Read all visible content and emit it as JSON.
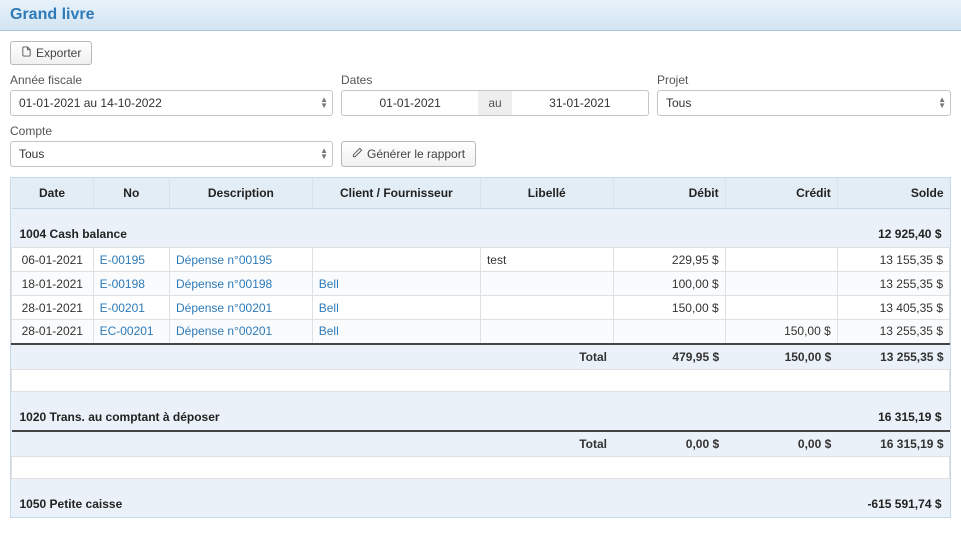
{
  "title": "Grand livre",
  "buttons": {
    "export": "Exporter",
    "generate": "Générer le rapport"
  },
  "filters": {
    "fiscal_year": {
      "label": "Année fiscale",
      "value": "01-01-2021 au 14-10-2022"
    },
    "dates": {
      "label": "Dates",
      "from": "01-01-2021",
      "sep": "au",
      "to": "31-01-2021"
    },
    "project": {
      "label": "Projet",
      "value": "Tous"
    },
    "account": {
      "label": "Compte",
      "value": "Tous"
    }
  },
  "columns": {
    "date": "Date",
    "no": "No",
    "desc": "Description",
    "cf": "Client / Fournisseur",
    "lib": "Libellé",
    "deb": "Débit",
    "cre": "Crédit",
    "sol": "Solde"
  },
  "sections": [
    {
      "name": "1004 Cash balance",
      "balance": "12 925,40 $",
      "rows": [
        {
          "date": "06-01-2021",
          "no": "E-00195",
          "desc": "Dépense n°00195",
          "cf": "",
          "lib": "test",
          "deb": "229,95 $",
          "cre": "",
          "sol": "13 155,35 $"
        },
        {
          "date": "18-01-2021",
          "no": "E-00198",
          "desc": "Dépense n°00198",
          "cf": "Bell",
          "lib": "",
          "deb": "100,00 $",
          "cre": "",
          "sol": "13 255,35 $"
        },
        {
          "date": "28-01-2021",
          "no": "E-00201",
          "desc": "Dépense n°00201",
          "cf": "Bell",
          "lib": "",
          "deb": "150,00 $",
          "cre": "",
          "sol": "13 405,35 $"
        },
        {
          "date": "28-01-2021",
          "no": "EC-00201",
          "desc": "Dépense n°00201",
          "cf": "Bell",
          "lib": "",
          "deb": "",
          "cre": "150,00 $",
          "sol": "13 255,35 $"
        }
      ],
      "total": {
        "label": "Total",
        "deb": "479,95 $",
        "cre": "150,00 $",
        "sol": "13 255,35 $"
      }
    },
    {
      "name": "1020 Trans. au comptant à déposer",
      "balance": "16 315,19 $",
      "rows": [],
      "total": {
        "label": "Total",
        "deb": "0,00 $",
        "cre": "0,00 $",
        "sol": "16 315,19 $"
      }
    },
    {
      "name": "1050 Petite caisse",
      "balance": "-615 591,74 $",
      "rows": [],
      "total": null
    }
  ]
}
